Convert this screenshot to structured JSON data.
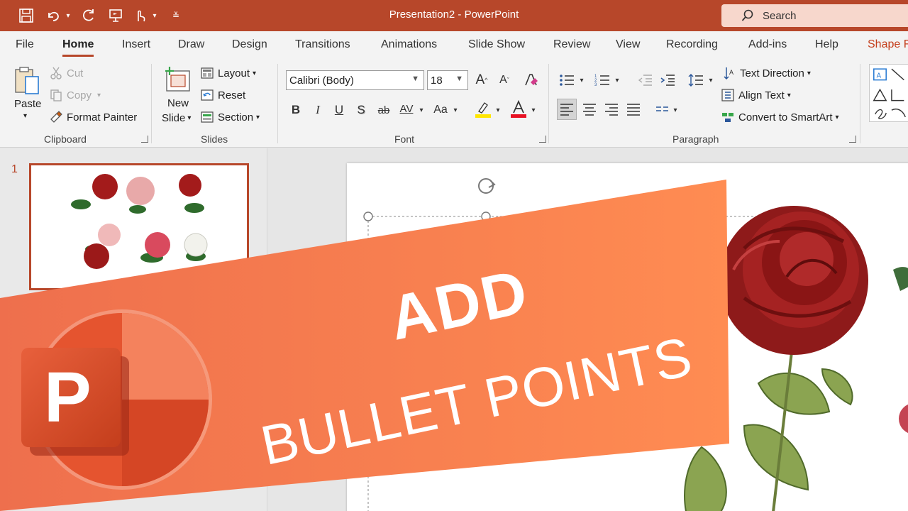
{
  "app": {
    "title": "Presentation2  -  PowerPoint",
    "search_label": "Search"
  },
  "tabs": [
    "File",
    "Home",
    "Insert",
    "Draw",
    "Design",
    "Transitions",
    "Animations",
    "Slide Show",
    "Review",
    "View",
    "Recording",
    "Add-ins",
    "Help",
    "Shape F"
  ],
  "active_tab": "Home",
  "clipboard": {
    "paste": "Paste",
    "cut": "Cut",
    "copy": "Copy",
    "format_painter": "Format Painter",
    "label": "Clipboard"
  },
  "slides": {
    "new_slide_1": "New",
    "new_slide_2": "Slide",
    "layout": "Layout",
    "reset": "Reset",
    "section": "Section",
    "label": "Slides"
  },
  "font": {
    "name": "Calibri (Body)",
    "size": "18",
    "label": "Font",
    "change_case": "Aa",
    "bold": "B",
    "italic": "I",
    "underline": "U",
    "shadow": "S",
    "strike": "ab",
    "spacing": "AV",
    "grow": "A",
    "shrink": "A"
  },
  "paragraph": {
    "text_direction": "Text Direction",
    "align_text": "Align Text",
    "convert": "Convert to SmartArt",
    "label": "Paragraph"
  },
  "slide_panel": {
    "number": "1"
  },
  "banner": {
    "line1": "ADD",
    "line2": "BULLET POINTS",
    "logo_letter": "P"
  },
  "colors": {
    "accent": "#b7472a",
    "banner_start": "#f27a55",
    "banner_end": "#ff8a4c",
    "highlight": "#ffe600",
    "font_color": "#e81123"
  }
}
